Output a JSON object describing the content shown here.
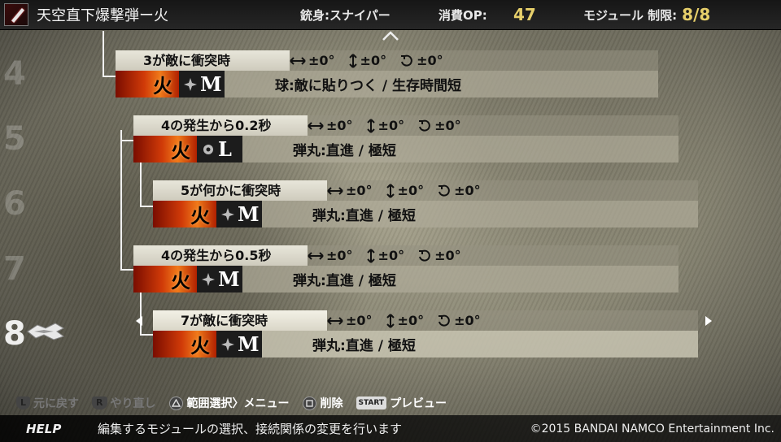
{
  "header": {
    "weapon_name": "天空直下爆撃弾ー火",
    "barrel_label": "銃身:スナイパー",
    "op_label": "消費OP:",
    "op_value": "47",
    "module_label": "モジュール 制限:",
    "module_value": "8/8"
  },
  "row_numbers": [
    "4",
    "5",
    "6",
    "7",
    "8"
  ],
  "modules": [
    {
      "trigger": "3が敵に衝突時",
      "h": "±0°",
      "v": "±0°",
      "r": "±0°",
      "element": "火",
      "size": "M",
      "desc": "球:敵に貼りつく / 生存時間短"
    },
    {
      "trigger": "4の発生から0.2秒",
      "h": "±0°",
      "v": "±0°",
      "r": "±0°",
      "element": "火",
      "size": "L",
      "desc": "弾丸:直進 / 極短"
    },
    {
      "trigger": "5が何かに衝突時",
      "h": "±0°",
      "v": "±0°",
      "r": "±0°",
      "element": "火",
      "size": "M",
      "desc": "弾丸:直進 / 極短"
    },
    {
      "trigger": "4の発生から0.5秒",
      "h": "±0°",
      "v": "±0°",
      "r": "±0°",
      "element": "火",
      "size": "M",
      "desc": "弾丸:直進 / 極短"
    },
    {
      "trigger": "7が敵に衝突時",
      "h": "±0°",
      "v": "±0°",
      "r": "±0°",
      "element": "火",
      "size": "M",
      "desc": "弾丸:直進 / 極短"
    }
  ],
  "footer": {
    "undo_key": "L",
    "undo": "元に戻す",
    "redo_key": "R",
    "redo": "やり直し",
    "range_select": "範囲選択〉メニュー",
    "delete": "削除",
    "start_key": "START",
    "preview": "プレビュー"
  },
  "help": {
    "label": "HELP",
    "text": "編集するモジュールの選択、接続関係の変更を行います",
    "copyright": "©2015 BANDAI NAMCO Entertainment Inc."
  }
}
